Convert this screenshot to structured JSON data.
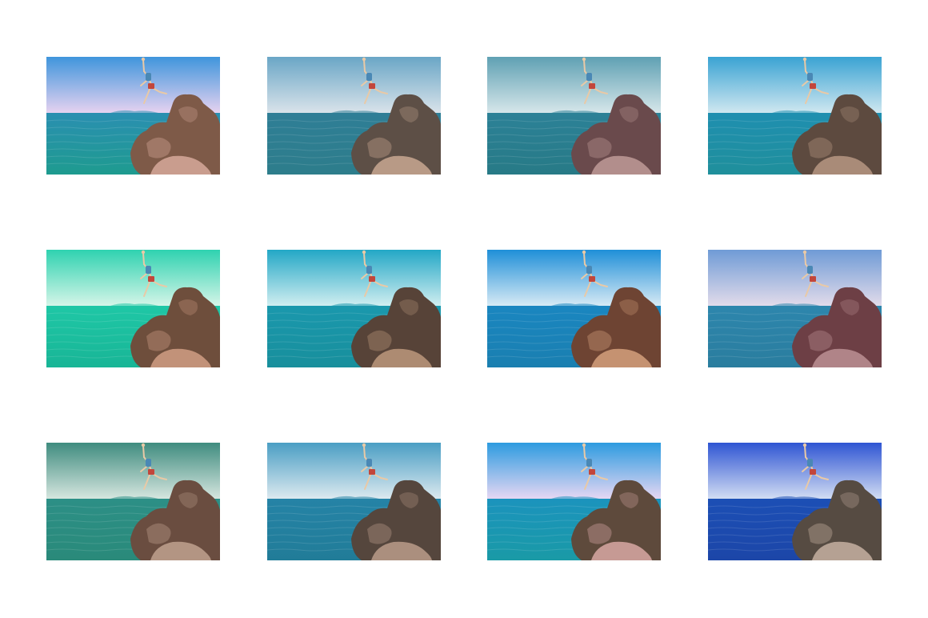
{
  "thumbnails": [
    {
      "sky_top": "#3f95dc",
      "sky_bottom": "#e6d2f0",
      "sea_top": "#2a8fb1",
      "sea_bottom": "#1e9b8f",
      "rock": "#7e5a48",
      "rock_light": "#c99d8e"
    },
    {
      "sky_top": "#6aa6c6",
      "sky_bottom": "#d9e3ea",
      "sea_top": "#2f7e96",
      "sea_bottom": "#2d7d8b",
      "rock": "#5d4f46",
      "rock_light": "#b89a86"
    },
    {
      "sky_top": "#5fa0b3",
      "sky_bottom": "#d6e6ea",
      "sea_top": "#2c8197",
      "sea_bottom": "#277a86",
      "rock": "#6a4a4c",
      "rock_light": "#b28e8c"
    },
    {
      "sky_top": "#3aa3d3",
      "sky_bottom": "#cfe7f0",
      "sea_top": "#1f8fb0",
      "sea_bottom": "#1f8f9b",
      "rock": "#5d4a3f",
      "rock_light": "#a98b78"
    },
    {
      "sky_top": "#2fd2b0",
      "sky_bottom": "#d5f5e8",
      "sea_top": "#1fc7a6",
      "sea_bottom": "#18b596",
      "rock": "#6e4e3c",
      "rock_light": "#c29279"
    },
    {
      "sky_top": "#23a7c6",
      "sky_bottom": "#d0eef0",
      "sea_top": "#1a98ad",
      "sea_bottom": "#188f9c",
      "rock": "#574338",
      "rock_light": "#ad8b72"
    },
    {
      "sky_top": "#1f8fd8",
      "sky_bottom": "#d7eaf5",
      "sea_top": "#1a86c0",
      "sea_bottom": "#1a7fb0",
      "rock": "#6e4433",
      "rock_light": "#c59271"
    },
    {
      "sky_top": "#6f9bd6",
      "sky_bottom": "#e2dbea",
      "sea_top": "#2d86ad",
      "sea_bottom": "#2a7d9e",
      "rock": "#6d3f45",
      "rock_light": "#b08488"
    },
    {
      "sky_top": "#3f8c7f",
      "sky_bottom": "#d6e6df",
      "sea_top": "#2c8f86",
      "sea_bottom": "#2a8a7a",
      "rock": "#6a4d40",
      "rock_light": "#b39583"
    },
    {
      "sky_top": "#4a9ec4",
      "sky_bottom": "#dce9ef",
      "sea_top": "#2583a6",
      "sea_bottom": "#217c98",
      "rock": "#55463d",
      "rock_light": "#ab8f7e"
    },
    {
      "sky_top": "#2d9be0",
      "sky_bottom": "#e6d7f3",
      "sea_top": "#1b93bd",
      "sea_bottom": "#1a9aa6",
      "rock": "#5e4a3c",
      "rock_light": "#c69a94"
    },
    {
      "sky_top": "#2f55d3",
      "sky_bottom": "#d2ddf3",
      "sea_top": "#1c4fb5",
      "sea_bottom": "#1c46a8",
      "rock": "#564b42",
      "rock_light": "#b5a193"
    }
  ]
}
